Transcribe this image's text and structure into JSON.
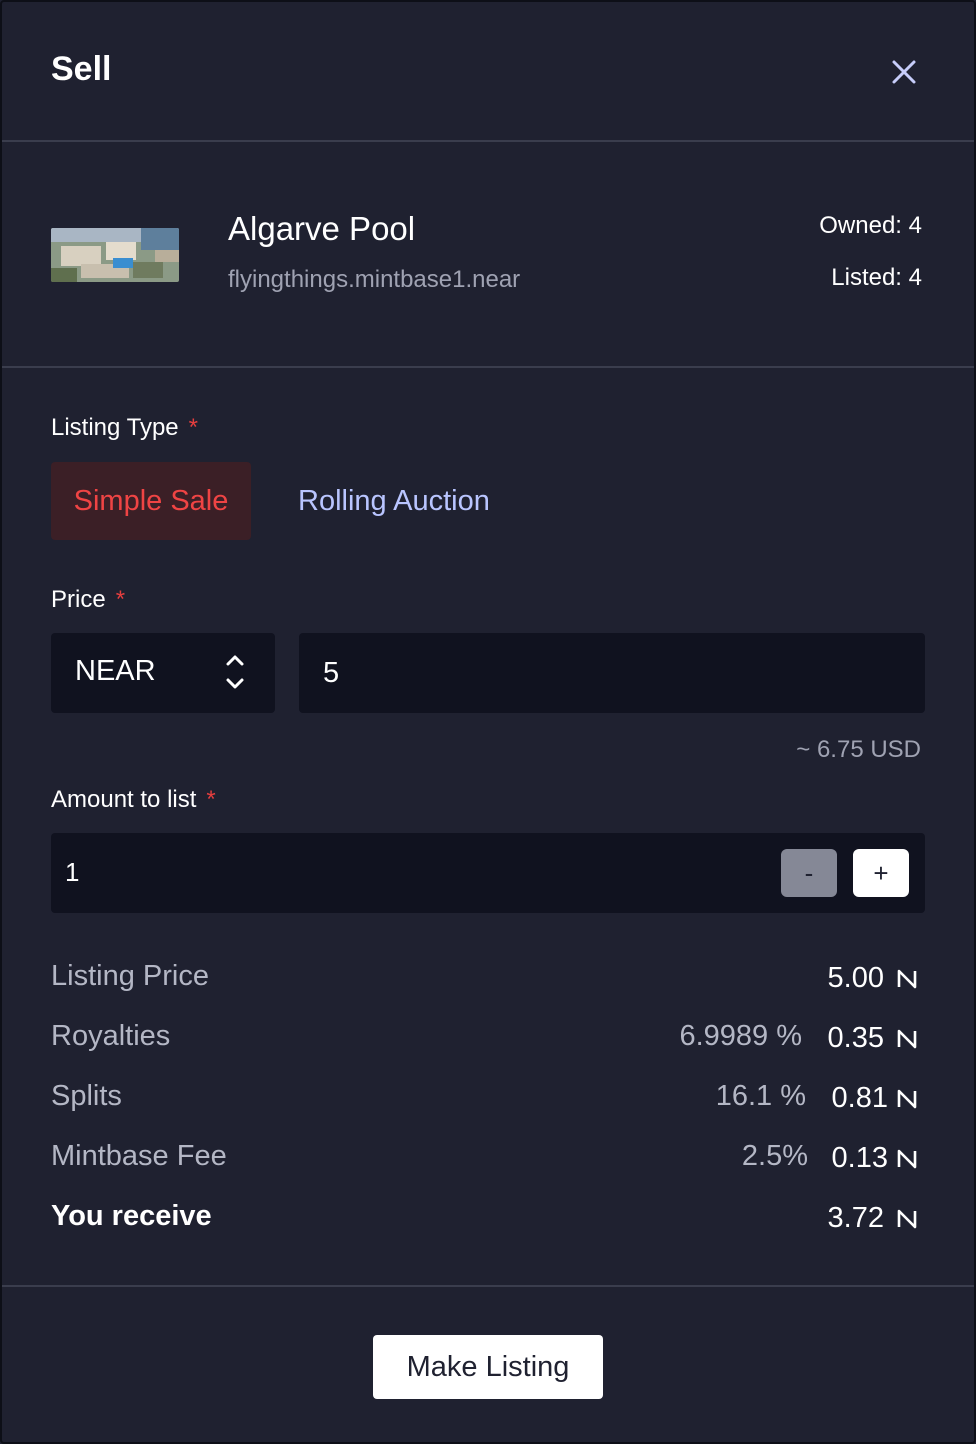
{
  "header": {
    "title": "Sell"
  },
  "product": {
    "name": "Algarve Pool",
    "store": "flyingthings.mintbase1.near",
    "owned": "Owned: 4",
    "listed": "Listed: 4"
  },
  "listing_type": {
    "label": "Listing Type",
    "required_mark": "*",
    "options": [
      "Simple Sale",
      "Rolling Auction"
    ],
    "selected": "Simple Sale"
  },
  "price": {
    "label": "Price",
    "required_mark": "*",
    "currency": "NEAR",
    "value": "5",
    "usd_estimate": "~ 6.75 USD"
  },
  "amount": {
    "label": "Amount to list",
    "required_mark": "*",
    "value": "1",
    "minus_label": "-",
    "plus_label": "+"
  },
  "summary": {
    "listing_price": {
      "label": "Listing Price",
      "value": "5.00"
    },
    "royalties": {
      "label": "Royalties",
      "percent": "6.9989 %",
      "value": "0.35"
    },
    "splits": {
      "label": "Splits",
      "percent": "16.1 %",
      "value": "0.81"
    },
    "mintbase_fee": {
      "label": "Mintbase Fee",
      "percent": "2.5%",
      "value": "0.13"
    },
    "you_receive": {
      "label": "You receive",
      "value": "3.72"
    }
  },
  "footer": {
    "make_listing_label": "Make Listing"
  },
  "colors": {
    "background": "#1f2130",
    "input_bg": "#10121f",
    "accent_red": "#ef4444",
    "accent_blue": "#b9c5ff"
  }
}
